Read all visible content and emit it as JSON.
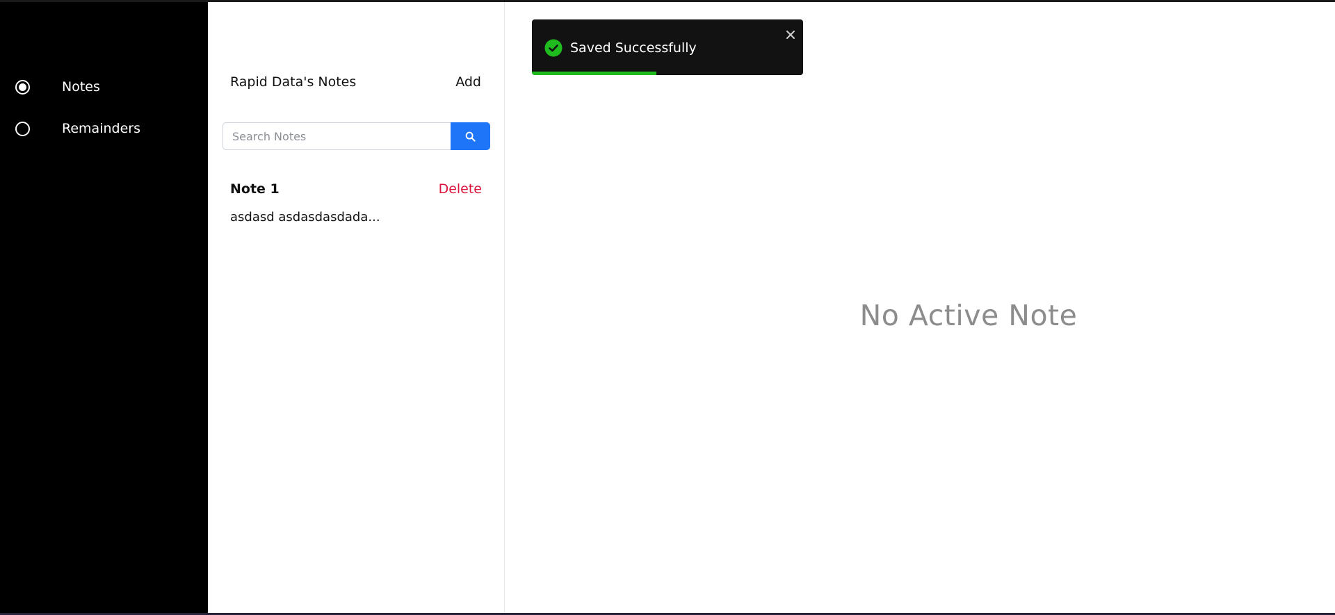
{
  "sidebar": {
    "items": [
      {
        "label": "Notes",
        "selected": true,
        "icon": "radio-selected-icon"
      },
      {
        "label": "Remainders",
        "selected": false,
        "icon": "radio-empty-icon"
      }
    ]
  },
  "notes_panel": {
    "title": "Rapid Data's Notes",
    "add_label": "Add",
    "search": {
      "placeholder": "Search Notes",
      "value": "",
      "icon": "search-icon"
    },
    "notes": [
      {
        "title": "Note 1",
        "delete_label": "Delete",
        "preview": "asdasd asdasdasdada..."
      }
    ]
  },
  "main": {
    "empty_message": "No Active Note"
  },
  "toast": {
    "message": "Saved Successfully",
    "icon": "check-circle-icon",
    "progress": 0.46,
    "colors": {
      "background": "#121212",
      "progress": "#1fbb1f",
      "icon": "#1fbb1f"
    }
  },
  "colors": {
    "sidebar": "#000000",
    "accent": "#1f75f7",
    "danger": "#dc143c"
  }
}
